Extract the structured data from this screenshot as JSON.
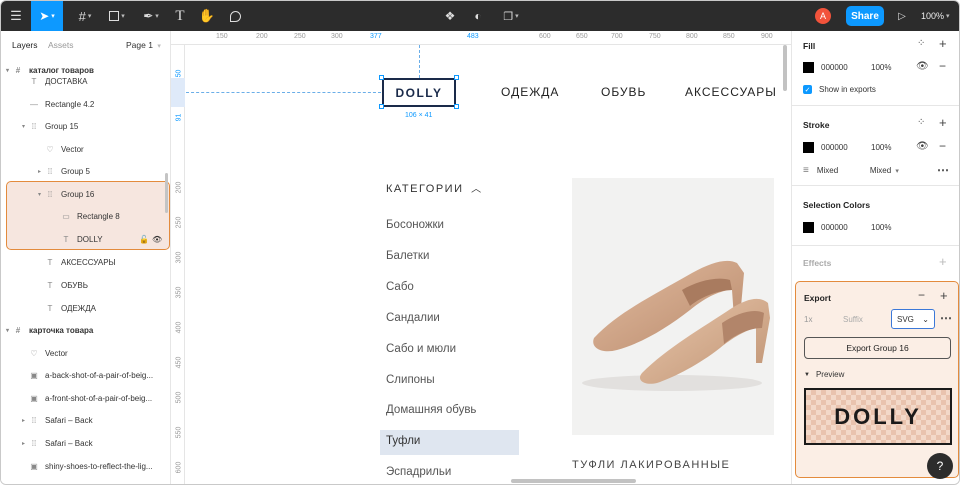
{
  "toolbar": {
    "avatar_letter": "A",
    "share_label": "Share",
    "zoom_label": "100%"
  },
  "layers_panel": {
    "tab_layers": "Layers",
    "tab_assets": "Assets",
    "page_selector": "Page 1",
    "items": [
      {
        "label": "каталог товаров",
        "icon": "frame-icon"
      },
      {
        "label": "ДОСТАВКА",
        "icon": "text-icon"
      },
      {
        "label": "Rectangle 4.2",
        "icon": "line-icon"
      },
      {
        "label": "Group 15",
        "icon": "group-icon"
      },
      {
        "label": "Vector",
        "icon": "vector-icon"
      },
      {
        "label": "Group 5",
        "icon": "group-icon"
      },
      {
        "label": "Group 16",
        "icon": "group-icon"
      },
      {
        "label": "Rectangle 8",
        "icon": "rectangle-icon"
      },
      {
        "label": "DOLLY",
        "icon": "text-icon"
      },
      {
        "label": "АКСЕССУАРЫ",
        "icon": "text-icon"
      },
      {
        "label": "ОБУВЬ",
        "icon": "text-icon"
      },
      {
        "label": "ОДЕЖДА",
        "icon": "text-icon"
      },
      {
        "label": "карточка товара",
        "icon": "frame-icon"
      },
      {
        "label": "Vector",
        "icon": "vector-icon"
      },
      {
        "label": "a-back-shot-of-a-pair-of-beig...",
        "icon": "image-icon"
      },
      {
        "label": "a-front-shot-of-a-pair-of-beig...",
        "icon": "image-icon"
      },
      {
        "label": "Safari – Back",
        "icon": "group-icon"
      },
      {
        "label": "Safari – Back",
        "icon": "group-icon"
      },
      {
        "label": "shiny-shoes-to-reflect-the-lig...",
        "icon": "image-icon"
      }
    ]
  },
  "rulers": {
    "top": [
      "150",
      "200",
      "250",
      "300",
      "377",
      "483",
      "600",
      "650",
      "700",
      "750",
      "800",
      "850",
      "900"
    ],
    "left": [
      "50",
      "91",
      "200",
      "250",
      "300",
      "350",
      "400",
      "450",
      "500",
      "550",
      "600"
    ]
  },
  "canvas": {
    "logo": "DOLLY",
    "dimension_label": "106 × 41",
    "nav": [
      "ОДЕЖДА",
      "ОБУВЬ",
      "АКСЕССУАРЫ"
    ],
    "category_heading": "КАТЕГОРИИ",
    "categories": [
      "Босоножки",
      "Балетки",
      "Сабо",
      "Сандалии",
      "Сабо и мюли",
      "Слипоны",
      "Домашняя обувь",
      "Туфли",
      "Эспадрильи"
    ],
    "selected_category": "Туфли",
    "product_title": "ТУФЛИ ЛАКИРОВАННЫЕ"
  },
  "design_panel": {
    "fill": {
      "title": "Fill",
      "hex": "000000",
      "opacity": "100%",
      "show_in_exports": "Show in exports"
    },
    "stroke": {
      "title": "Stroke",
      "hex": "000000",
      "opacity": "100%",
      "weight_label": "Mixed",
      "align_label": "Mixed"
    },
    "selection_colors": {
      "title": "Selection Colors",
      "hex": "000000",
      "opacity": "100%"
    },
    "effects": {
      "title": "Effects"
    },
    "export": {
      "title": "Export",
      "scale": "1x",
      "suffix_placeholder": "Suffix",
      "format": "SVG",
      "button_label": "Export Group 16",
      "preview_label": "Preview",
      "preview_text": "DOLLY"
    }
  },
  "help_label": "?"
}
